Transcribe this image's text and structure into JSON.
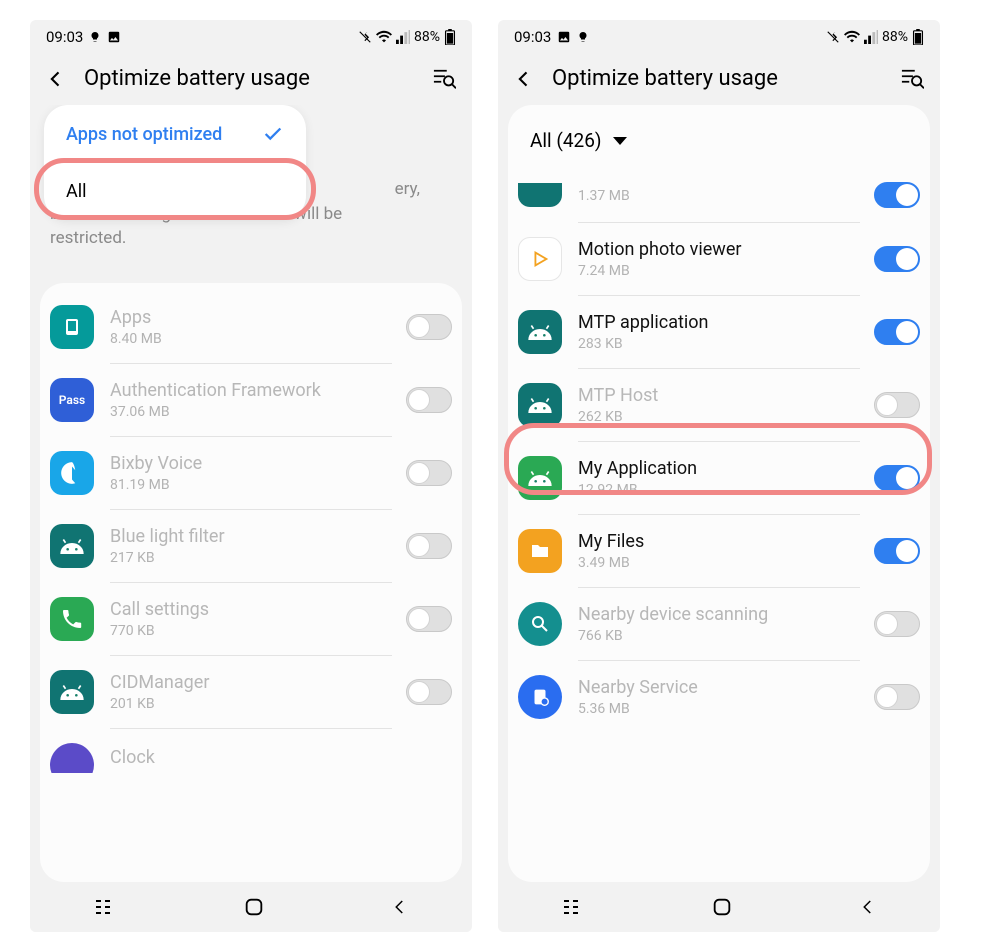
{
  "status": {
    "time": "09:03",
    "battery": "88%"
  },
  "header": {
    "title": "Optimize battery usage"
  },
  "screen1": {
    "dropdown": {
      "selected": "Apps not optimized",
      "other": "All"
    },
    "desc_partial_top": "ery,",
    "desc_line2": "but some background functions will be",
    "desc_line3": "restricted.",
    "apps": [
      {
        "name": "Apps",
        "size": "8.40 MB",
        "icon": "teal",
        "on": false,
        "faded": true
      },
      {
        "name": "Authentication Framework",
        "size": "37.06 MB",
        "icon": "blue",
        "on": false,
        "faded": true,
        "iconText": "Pass"
      },
      {
        "name": "Bixby Voice",
        "size": "81.19 MB",
        "icon": "cyan",
        "on": false,
        "faded": true
      },
      {
        "name": "Blue light filter",
        "size": "217 KB",
        "icon": "teal2",
        "on": false,
        "faded": true
      },
      {
        "name": "Call settings",
        "size": "770 KB",
        "icon": "green",
        "on": false,
        "faded": true
      },
      {
        "name": "CIDManager",
        "size": "201 KB",
        "icon": "teal2",
        "on": false,
        "faded": true
      },
      {
        "name": "Clock",
        "size": "",
        "icon": "purple",
        "on": false,
        "faded": true
      }
    ]
  },
  "screen2": {
    "filter": "All (426)",
    "partial": {
      "size": "1.37 MB",
      "on": true
    },
    "apps": [
      {
        "name": "Motion photo viewer",
        "size": "7.24 MB",
        "icon": "white",
        "on": true,
        "faded": false
      },
      {
        "name": "MTP application",
        "size": "283 KB",
        "icon": "teal2",
        "on": true,
        "faded": false
      },
      {
        "name": "MTP Host",
        "size": "262 KB",
        "icon": "teal2",
        "on": false,
        "faded": true
      },
      {
        "name": "My Application",
        "size": "12.92 MB",
        "icon": "green",
        "on": true,
        "faded": false
      },
      {
        "name": "My Files",
        "size": "3.49 MB",
        "icon": "orange",
        "on": true,
        "faded": false
      },
      {
        "name": "Nearby device scanning",
        "size": "766 KB",
        "icon": "tealr",
        "on": false,
        "faded": true
      },
      {
        "name": "Nearby Service",
        "size": "5.36 MB",
        "icon": "bluer",
        "on": false,
        "faded": true
      }
    ]
  }
}
